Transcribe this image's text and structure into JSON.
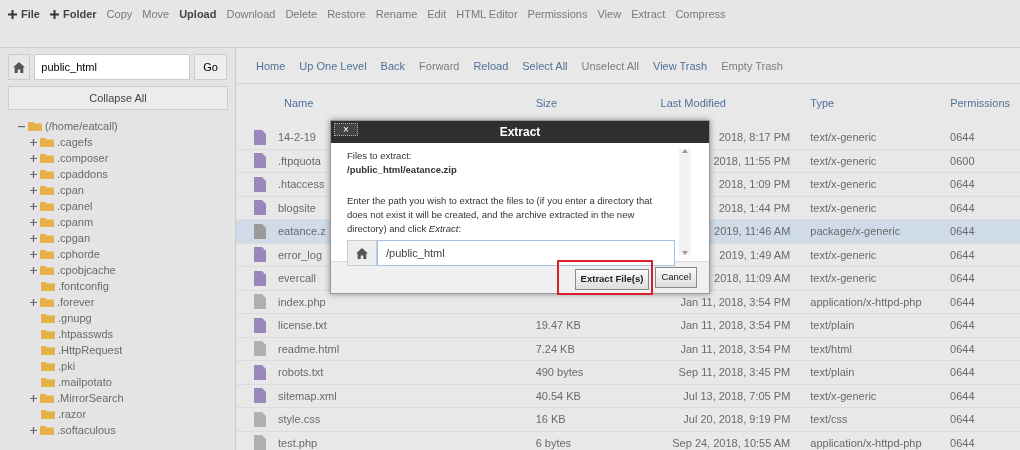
{
  "toolbar": [
    {
      "label": "File",
      "disabled": false,
      "kind": "add"
    },
    {
      "label": "Folder",
      "disabled": false,
      "kind": "add"
    },
    {
      "label": "Copy",
      "disabled": true,
      "kind": "plain"
    },
    {
      "label": "Move",
      "disabled": true,
      "kind": "plain"
    },
    {
      "label": "Upload",
      "disabled": false,
      "kind": "plain"
    },
    {
      "label": "Download",
      "disabled": true,
      "kind": "plain"
    },
    {
      "label": "Delete",
      "disabled": true,
      "kind": "plain"
    },
    {
      "label": "Restore",
      "disabled": true,
      "kind": "plain"
    },
    {
      "label": "Rename",
      "disabled": true,
      "kind": "plain"
    },
    {
      "label": "Edit",
      "disabled": true,
      "kind": "plain"
    },
    {
      "label": "HTML Editor",
      "disabled": true,
      "kind": "plain"
    },
    {
      "label": "Permissions",
      "disabled": true,
      "kind": "plain"
    },
    {
      "label": "View",
      "disabled": true,
      "kind": "plain"
    },
    {
      "label": "Extract",
      "disabled": true,
      "kind": "plain"
    },
    {
      "label": "Compress",
      "disabled": true,
      "kind": "plain"
    }
  ],
  "sidebar": {
    "path_value": "public_html",
    "go_button": "Go",
    "collapse_button": "Collapse All",
    "tree": [
      {
        "label": "(/home/eatcall)",
        "expandable": true,
        "children": [
          {
            "label": ".cagefs",
            "expandable": true
          },
          {
            "label": ".composer",
            "expandable": true
          },
          {
            "label": ".cpaddons",
            "expandable": true
          },
          {
            "label": ".cpan",
            "expandable": true
          },
          {
            "label": ".cpanel",
            "expandable": true
          },
          {
            "label": ".cpanm",
            "expandable": true
          },
          {
            "label": ".cpgan",
            "expandable": true
          },
          {
            "label": ".cphorde",
            "expandable": true
          },
          {
            "label": ".cpobjcache",
            "expandable": true
          },
          {
            "label": ".fontconfig",
            "expandable": false
          },
          {
            "label": ".forever",
            "expandable": true
          },
          {
            "label": ".gnupg",
            "expandable": false
          },
          {
            "label": ".htpasswds",
            "expandable": false
          },
          {
            "label": ".HttpRequest",
            "expandable": false
          },
          {
            "label": ".pki",
            "expandable": false
          },
          {
            "label": ".mailpotato",
            "expandable": false
          },
          {
            "label": ".MirrorSearch",
            "expandable": true
          },
          {
            "label": ".razor",
            "expandable": false
          },
          {
            "label": ".softaculous",
            "expandable": true
          }
        ]
      }
    ]
  },
  "navbar": [
    {
      "label": "Home",
      "disabled": false
    },
    {
      "label": "Up One Level",
      "disabled": false
    },
    {
      "label": "Back",
      "disabled": false
    },
    {
      "label": "Forward",
      "disabled": true
    },
    {
      "label": "Reload",
      "disabled": false
    },
    {
      "label": "Select All",
      "disabled": false
    },
    {
      "label": "Unselect All",
      "disabled": true
    },
    {
      "label": "View Trash",
      "disabled": false
    },
    {
      "label": "Empty Trash",
      "disabled": true
    }
  ],
  "table": {
    "columns": [
      "Name",
      "Size",
      "Last Modified",
      "Type",
      "Permissions"
    ],
    "rows": [
      {
        "name": "14-2-19",
        "size": "",
        "modified": "2018, 8:17 PM",
        "type": "text/x-generic",
        "perms": "0644",
        "selected": false,
        "kind": "file"
      },
      {
        "name": ".ftpquota",
        "size": "",
        "modified": "2018, 11:55 PM",
        "type": "text/x-generic",
        "perms": "0600",
        "selected": false,
        "kind": "file"
      },
      {
        "name": ".htaccess",
        "size": "",
        "modified": "2018, 1:09 PM",
        "type": "text/x-generic",
        "perms": "0644",
        "selected": false,
        "kind": "file"
      },
      {
        "name": "blogsite",
        "size": "",
        "modified": "2018, 1:44 PM",
        "type": "text/x-generic",
        "perms": "0644",
        "selected": false,
        "kind": "file"
      },
      {
        "name": "eatance.z",
        "size": "",
        "modified": "2019, 11:46 AM",
        "type": "package/x-generic",
        "perms": "0644",
        "selected": true,
        "kind": "archive"
      },
      {
        "name": "error_log",
        "size": "",
        "modified": "2019, 1:49 AM",
        "type": "text/x-generic",
        "perms": "0644",
        "selected": false,
        "kind": "file"
      },
      {
        "name": "evercall",
        "size": "",
        "modified": "2018, 11:09 AM",
        "type": "text/x-generic",
        "perms": "0644",
        "selected": false,
        "kind": "file"
      },
      {
        "name": "index.php",
        "size": "",
        "modified": "Jan 11, 2018, 3:54 PM",
        "type": "application/x-httpd-php",
        "perms": "0644",
        "selected": false,
        "kind": "code"
      },
      {
        "name": "license.txt",
        "size": "19.47 KB",
        "modified": "Jan 11, 2018, 3:54 PM",
        "type": "text/plain",
        "perms": "0644",
        "selected": false,
        "kind": "file"
      },
      {
        "name": "readme.html",
        "size": "7.24 KB",
        "modified": "Jan 11, 2018, 3:54 PM",
        "type": "text/html",
        "perms": "0644",
        "selected": false,
        "kind": "code"
      },
      {
        "name": "robots.txt",
        "size": "490 bytes",
        "modified": "Sep 11, 2018, 3:45 PM",
        "type": "text/plain",
        "perms": "0644",
        "selected": false,
        "kind": "file"
      },
      {
        "name": "sitemap.xml",
        "size": "40.54 KB",
        "modified": "Jul 13, 2018, 7:05 PM",
        "type": "text/x-generic",
        "perms": "0644",
        "selected": false,
        "kind": "file"
      },
      {
        "name": "style.css",
        "size": "16 KB",
        "modified": "Jul 20, 2018, 9:19 PM",
        "type": "text/css",
        "perms": "0644",
        "selected": false,
        "kind": "code"
      },
      {
        "name": "test.php",
        "size": "6 bytes",
        "modified": "Sep 24, 2018, 10:55 AM",
        "type": "application/x-httpd-php",
        "perms": "0644",
        "selected": false,
        "kind": "code"
      }
    ]
  },
  "dialog": {
    "title": "Extract",
    "close": "×",
    "files_label": "Files to extract:",
    "files_path": "/public_html/eatance.zip",
    "instruction": "Enter the path you wish to extract the files to (if you enter a directory that does not exist it will be created, and the archive extracted in the new directory) and click *Extract*:",
    "path_value": "/public_html",
    "buttons": [
      {
        "label": "Extract File(s)",
        "highlighted": true
      },
      {
        "label": "Cancel",
        "highlighted": false
      }
    ]
  }
}
